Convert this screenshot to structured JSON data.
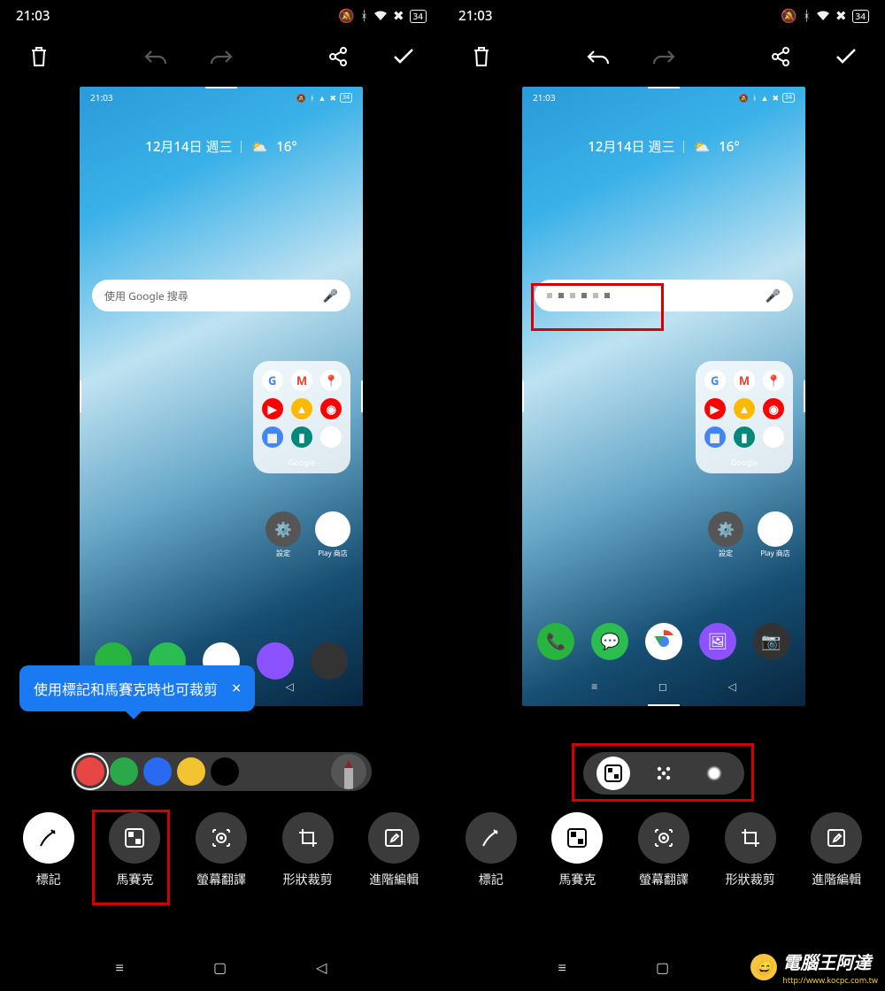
{
  "status": {
    "time": "21:03",
    "battery": "34",
    "icons": [
      "bell-slash",
      "bluetooth",
      "wifi",
      "close"
    ]
  },
  "editor_toolbar": {
    "delete": "delete",
    "undo": "undo",
    "redo": "redo",
    "share": "share",
    "confirm": "confirm"
  },
  "phone": {
    "time": "21:03",
    "battery": "34",
    "date": "12月14日 週三",
    "weather": "16°",
    "search_placeholder": "使用 Google 搜尋",
    "folder_label": "Google",
    "settings_label": "設定",
    "playstore_label": "Play 商店"
  },
  "tip": {
    "text": "使用標記和馬賽克時也可裁剪",
    "close": "×"
  },
  "colors": {
    "red": "#e84545",
    "green": "#2aa84a",
    "blue": "#2a6af0",
    "yellow": "#f2c431",
    "black": "#000000"
  },
  "tools": [
    {
      "key": "markup",
      "label": "標記"
    },
    {
      "key": "mosaic",
      "label": "馬賽克"
    },
    {
      "key": "translate",
      "label": "螢幕翻譯"
    },
    {
      "key": "shapecrop",
      "label": "形狀裁剪"
    },
    {
      "key": "advanced",
      "label": "進階編輯"
    }
  ],
  "mosaic_styles": [
    "pixel",
    "pattern",
    "blur"
  ],
  "watermark": {
    "title": "電腦王阿達",
    "url": "http://www.kocpc.com.tw"
  }
}
